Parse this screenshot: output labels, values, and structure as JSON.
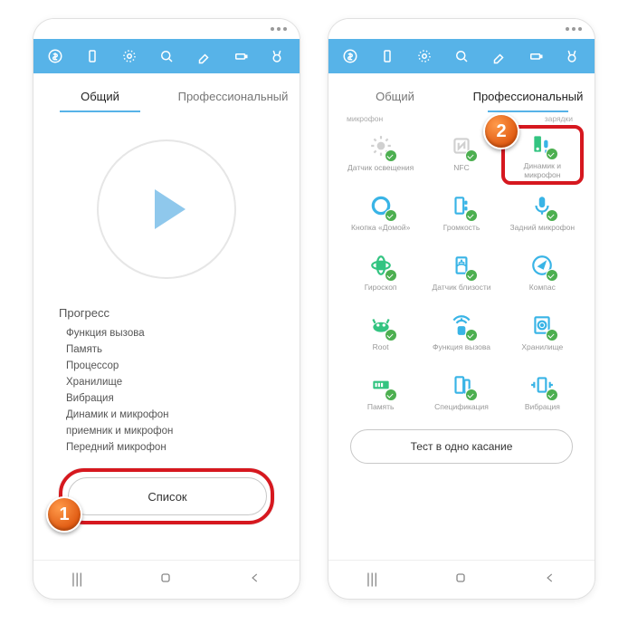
{
  "left": {
    "tabs": {
      "general": "Общий",
      "pro": "Профессиональный",
      "active": 0
    },
    "progress_title": "Прогресс",
    "progress_items": [
      "Функция вызова",
      "Память",
      "Процессор",
      "Хранилище",
      "Вибрация",
      "Динамик и микрофон",
      "приемник и микрофон",
      "Передний микрофон"
    ],
    "list_button": "Список"
  },
  "right": {
    "tabs": {
      "general": "Общий",
      "pro": "Профессиональный",
      "active": 1
    },
    "header_left": "микрофон",
    "header_right": "зарядки",
    "grid": [
      {
        "label": "Датчик освещения",
        "icon": "sun"
      },
      {
        "label": "NFC",
        "icon": "nfc"
      },
      {
        "label": "Динамик и микрофон",
        "icon": "speaker-mic",
        "highlight": true
      },
      {
        "label": "Кнопка «Домой»",
        "icon": "home-circle"
      },
      {
        "label": "Громкость",
        "icon": "volume"
      },
      {
        "label": "Задний микрофон",
        "icon": "mic"
      },
      {
        "label": "Гироскоп",
        "icon": "gyro"
      },
      {
        "label": "Датчик близости",
        "icon": "proximity"
      },
      {
        "label": "Компас",
        "icon": "compass"
      },
      {
        "label": "Root",
        "icon": "root"
      },
      {
        "label": "Функция вызова",
        "icon": "call-signal"
      },
      {
        "label": "Хранилище",
        "icon": "storage"
      },
      {
        "label": "Память",
        "icon": "memory"
      },
      {
        "label": "Спецификация",
        "icon": "spec"
      },
      {
        "label": "Вибрация",
        "icon": "vibration"
      }
    ],
    "test_button": "Тест в одно касание"
  },
  "annotations": {
    "badge1": "1",
    "badge2": "2"
  },
  "colors": {
    "primary": "#57b3e8",
    "accent_green": "#33c481",
    "highlight": "#d6181f"
  }
}
